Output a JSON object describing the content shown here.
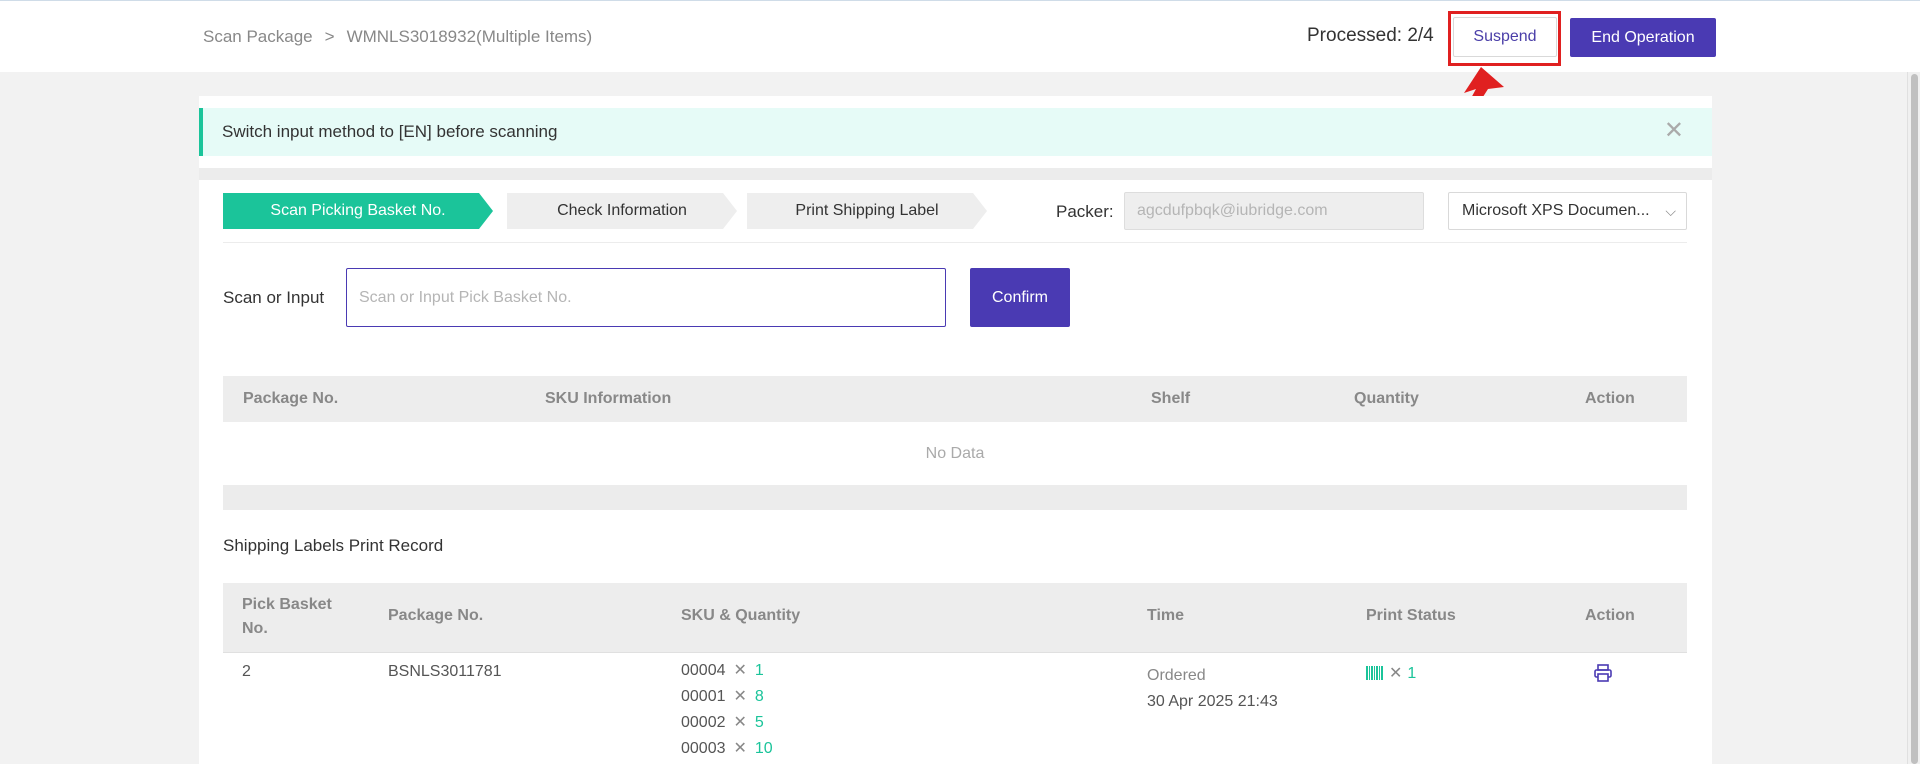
{
  "header": {
    "breadcrumb": [
      "Scan Package",
      ">",
      "WMNLS3018932(Multiple Items)"
    ],
    "processed": "Processed: 2/4",
    "suspend_label": "Suspend",
    "end_label": "End Operation"
  },
  "alert": {
    "text": "Switch input method to [EN] before scanning",
    "close": "✕"
  },
  "steps": [
    {
      "label": "Scan Picking Basket No.",
      "active": true
    },
    {
      "label": "Check Information",
      "active": false
    },
    {
      "label": "Print Shipping Label",
      "active": false
    }
  ],
  "packer": {
    "label": "Packer:",
    "value": "agcdufpbqk@iubridge.com"
  },
  "printer": {
    "selected": "Microsoft XPS Documen..."
  },
  "scan": {
    "label": "Scan or Input",
    "placeholder": "Scan or Input Pick Basket No.",
    "confirm_label": "Confirm"
  },
  "package_table": {
    "columns": [
      "Package No.",
      "SKU Information",
      "Shelf",
      "Quantity",
      "Action"
    ],
    "empty_text": "No Data"
  },
  "print_record": {
    "title": "Shipping Labels Print Record",
    "columns": [
      "Pick Basket No.",
      "Package No.",
      "SKU & Quantity",
      "Time",
      "Print Status",
      "Action"
    ],
    "rows": [
      {
        "pick_basket": "2",
        "package_no": "BSNLS3011781",
        "skus": [
          {
            "sku": "00004",
            "qty": "1"
          },
          {
            "sku": "00001",
            "qty": "8"
          },
          {
            "sku": "00002",
            "qty": "5"
          },
          {
            "sku": "00003",
            "qty": "10"
          }
        ],
        "time_status": "Ordered",
        "time_value": "30 Apr 2025 21:43",
        "print_count": "1"
      }
    ]
  },
  "colors": {
    "accent": "#4a3ab3",
    "success": "#1bc49a",
    "highlight": "#e02020"
  }
}
